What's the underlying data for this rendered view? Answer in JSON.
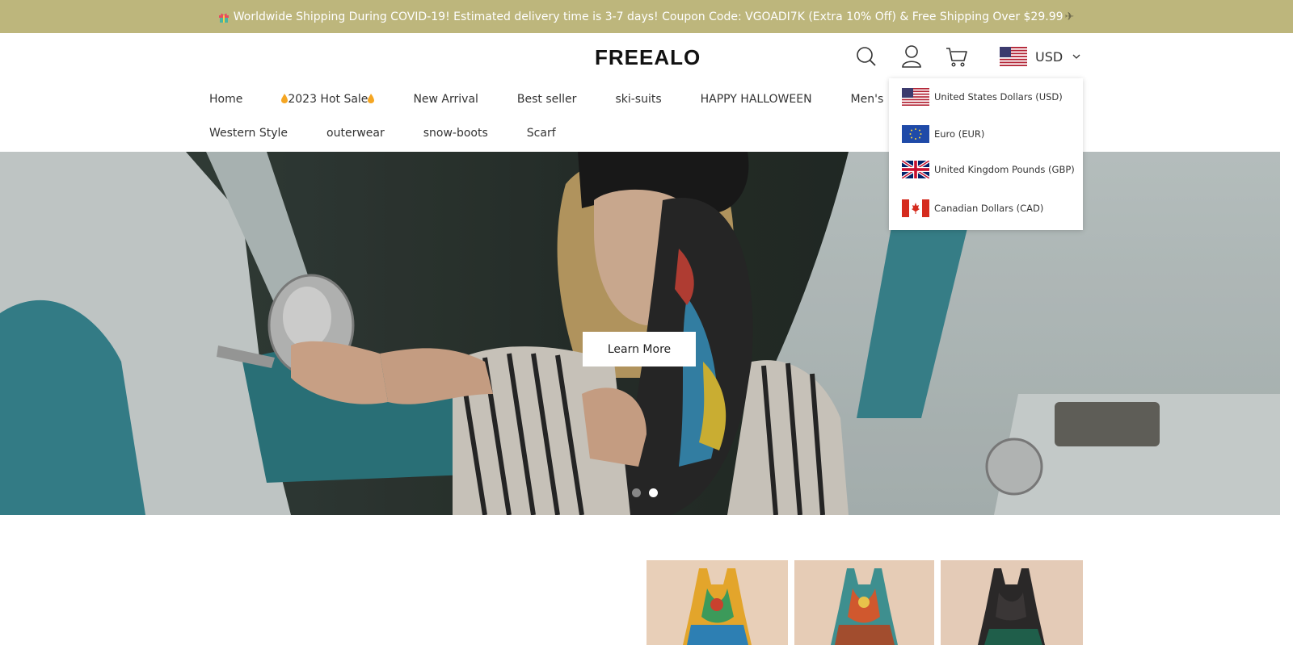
{
  "announcement": {
    "text": "Worldwide Shipping During COVID-19! Estimated delivery time is 3-7 days! Coupon Code: VGOADI7K (Extra 10% Off) & Free Shipping Over $29.99",
    "leading_icon": "gift-icon",
    "trailing_icon": "airplane-icon",
    "background": "#bdb67c"
  },
  "header": {
    "logo": "FREEALO",
    "icons": [
      "search-icon",
      "user-icon",
      "cart-icon"
    ],
    "currency": {
      "code": "USD",
      "flag": "us-flag"
    }
  },
  "nav": {
    "row1": [
      "Home",
      "2023 Hot Sale",
      "New Arrival",
      "Best seller",
      "ski-suits",
      "HAPPY HALLOWEEN",
      "Men's"
    ],
    "row2": [
      "Western Style",
      "outerwear",
      "snow-boots",
      "Scarf"
    ]
  },
  "hero": {
    "button_label": "Learn More",
    "slide_count": 2,
    "active_slide": 2
  },
  "currency_menu": {
    "options": [
      {
        "label": "United States Dollars (USD)",
        "flag": "us-flag"
      },
      {
        "label": "Euro (EUR)",
        "flag": "eu-flag"
      },
      {
        "label": "United Kingdom Pounds (GBP)",
        "flag": "uk-flag"
      },
      {
        "label": "Canadian Dollars (CAD)",
        "flag": "ca-flag"
      }
    ]
  },
  "products": {
    "items": [
      "dress-yellow-orange",
      "dress-teal-orange",
      "dress-black"
    ]
  }
}
